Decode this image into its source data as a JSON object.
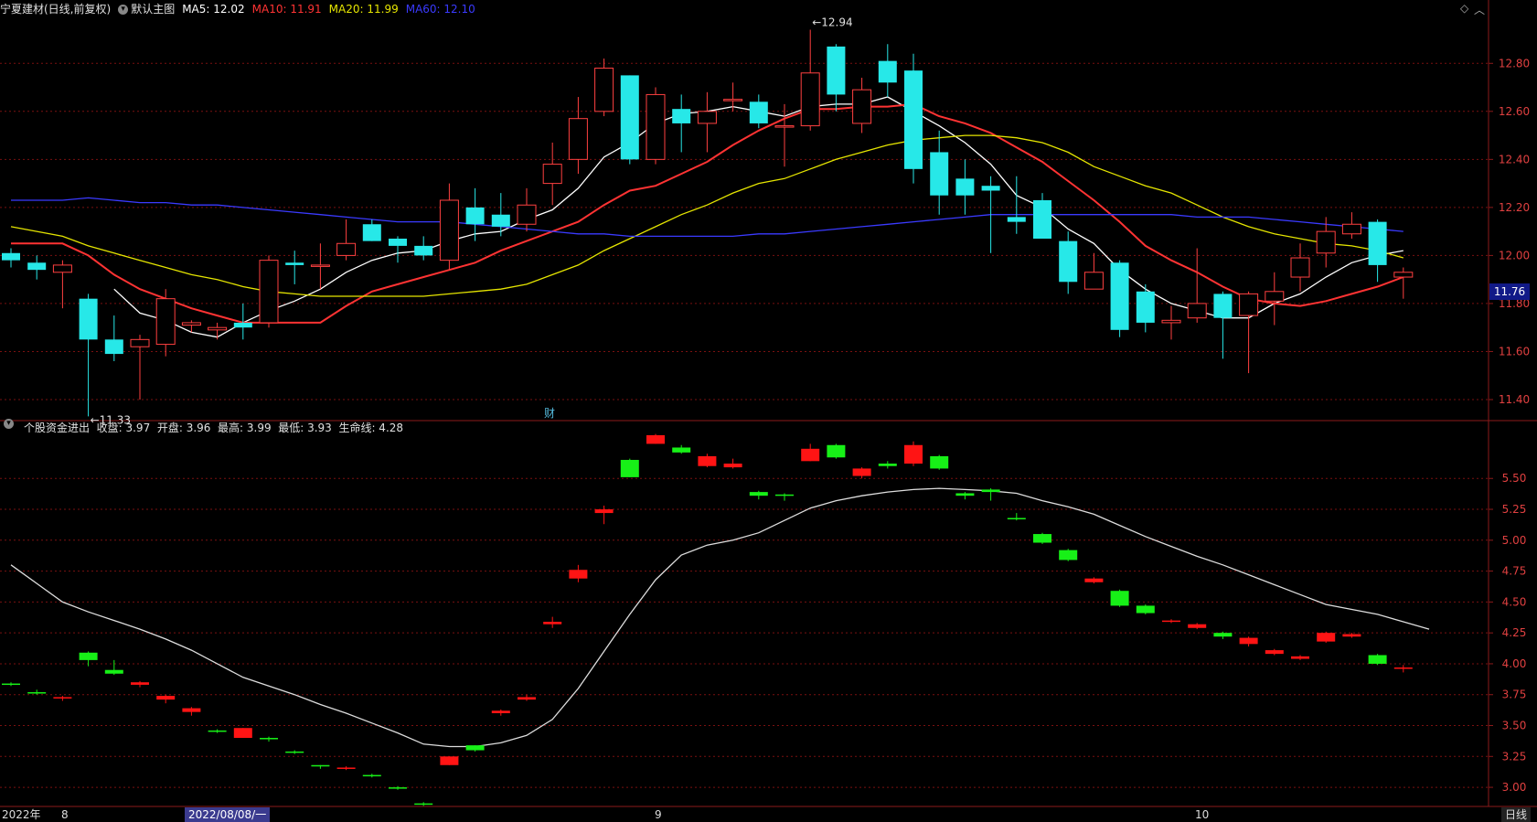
{
  "header": {
    "stock": "宁夏建材(日线,前复权)",
    "main_mode": "默认主图",
    "ma": [
      {
        "label": "MA5: 12.02",
        "color": "#ffffff"
      },
      {
        "label": "MA10: 11.91",
        "color": "#ff3333"
      },
      {
        "label": "MA20: 11.99",
        "color": "#e5e500"
      },
      {
        "label": "MA60: 12.10",
        "color": "#3a3aff"
      }
    ]
  },
  "indicator_header": "个股资金进出  收盘: 3.97  开盘: 3.96  最高: 3.99  最低: 3.93  生命线: 4.28",
  "current_price": "11.76",
  "fin_label": "财",
  "bottom_axis": {
    "labels": [
      "2022年",
      "8",
      "2022/08/08/一",
      "9",
      "10"
    ],
    "period": "日线"
  },
  "chart_data": [
    {
      "type": "candlestick",
      "title": "宁夏建材(日线,前复权)",
      "ylim": [
        11.32,
        12.98
      ],
      "yticks": [
        11.4,
        11.6,
        11.8,
        12.0,
        12.2,
        12.4,
        12.6,
        12.8
      ],
      "annotations": [
        {
          "text": "12.94",
          "bar": 31
        },
        {
          "text": "11.33",
          "bar": 3
        }
      ],
      "candles": [
        [
          12.01,
          11.98,
          12.03,
          11.95
        ],
        [
          11.97,
          11.94,
          12.0,
          11.9
        ],
        [
          11.93,
          11.96,
          11.98,
          11.78
        ],
        [
          11.82,
          11.65,
          11.84,
          11.33
        ],
        [
          11.65,
          11.59,
          11.75,
          11.56
        ],
        [
          11.62,
          11.65,
          11.67,
          11.4
        ],
        [
          11.63,
          11.82,
          11.86,
          11.58
        ],
        [
          11.71,
          11.72,
          11.73,
          11.68
        ],
        [
          11.69,
          11.7,
          11.72,
          11.65
        ],
        [
          11.72,
          11.7,
          11.8,
          11.65
        ],
        [
          11.72,
          11.98,
          12.0,
          11.7
        ],
        [
          11.97,
          11.96,
          12.02,
          11.88
        ],
        [
          11.96,
          11.96,
          12.05,
          11.86
        ],
        [
          12.0,
          12.05,
          12.15,
          11.98
        ],
        [
          12.13,
          12.06,
          12.15,
          12.06
        ],
        [
          12.07,
          12.04,
          12.08,
          11.97
        ],
        [
          12.04,
          12.0,
          12.08,
          11.98
        ],
        [
          11.98,
          12.23,
          12.3,
          11.94
        ],
        [
          12.2,
          12.13,
          12.28,
          12.06
        ],
        [
          12.17,
          12.12,
          12.26,
          12.08
        ],
        [
          12.13,
          12.21,
          12.28,
          12.1
        ],
        [
          12.3,
          12.38,
          12.47,
          12.21
        ],
        [
          12.4,
          12.57,
          12.66,
          12.34
        ],
        [
          12.6,
          12.78,
          12.82,
          12.58
        ],
        [
          12.75,
          12.4,
          12.75,
          12.38
        ],
        [
          12.4,
          12.67,
          12.7,
          12.38
        ],
        [
          12.61,
          12.55,
          12.67,
          12.43
        ],
        [
          12.55,
          12.6,
          12.68,
          12.43
        ],
        [
          12.65,
          12.65,
          12.72,
          12.6
        ],
        [
          12.64,
          12.55,
          12.67,
          12.53
        ],
        [
          12.54,
          12.54,
          12.63,
          12.37
        ],
        [
          12.54,
          12.76,
          12.94,
          12.52
        ],
        [
          12.87,
          12.67,
          12.88,
          12.6
        ],
        [
          12.55,
          12.69,
          12.74,
          12.51
        ],
        [
          12.81,
          12.72,
          12.88,
          12.66
        ],
        [
          12.77,
          12.36,
          12.84,
          12.3
        ],
        [
          12.43,
          12.25,
          12.52,
          12.17
        ],
        [
          12.32,
          12.25,
          12.4,
          12.17
        ],
        [
          12.29,
          12.27,
          12.33,
          12.01
        ],
        [
          12.16,
          12.14,
          12.33,
          12.09
        ],
        [
          12.23,
          12.07,
          12.26,
          12.07
        ],
        [
          12.06,
          11.89,
          12.1,
          11.84
        ],
        [
          11.86,
          11.93,
          12.01,
          11.87
        ],
        [
          11.97,
          11.69,
          11.98,
          11.66
        ],
        [
          11.85,
          11.72,
          11.88,
          11.68
        ],
        [
          11.72,
          11.73,
          11.79,
          11.65
        ],
        [
          11.74,
          11.8,
          12.03,
          11.72
        ],
        [
          11.84,
          11.74,
          11.85,
          11.57
        ],
        [
          11.75,
          11.84,
          11.85,
          11.51
        ],
        [
          11.81,
          11.85,
          11.93,
          11.71
        ],
        [
          11.91,
          11.99,
          12.05,
          11.85
        ],
        [
          12.01,
          12.1,
          12.16,
          11.95
        ],
        [
          12.09,
          12.13,
          12.18,
          12.07
        ],
        [
          12.14,
          11.96,
          12.15,
          11.89
        ],
        [
          11.91,
          11.93,
          11.95,
          11.82
        ]
      ],
      "series": [
        {
          "name": "MA5",
          "color": "#ffffff",
          "values": [
            null,
            null,
            null,
            null,
            11.86,
            11.76,
            11.73,
            11.68,
            11.66,
            11.72,
            11.77,
            11.81,
            11.86,
            11.93,
            11.98,
            12.01,
            12.02,
            12.06,
            12.09,
            12.1,
            12.15,
            12.19,
            12.28,
            12.41,
            12.47,
            12.55,
            12.59,
            12.6,
            12.62,
            12.6,
            12.58,
            12.62,
            12.63,
            12.63,
            12.66,
            12.6,
            12.54,
            12.47,
            12.38,
            12.25,
            12.2,
            12.11,
            12.05,
            11.94,
            11.86,
            11.8,
            11.77,
            11.74,
            11.74,
            11.8,
            11.84,
            11.91,
            11.97,
            12.0,
            12.02
          ]
        },
        {
          "name": "MA10",
          "color": "#ff3333",
          "values": [
            12.05,
            12.05,
            12.05,
            12.0,
            11.92,
            11.86,
            11.82,
            11.78,
            11.75,
            11.72,
            11.72,
            11.72,
            11.72,
            11.79,
            11.85,
            11.88,
            11.91,
            11.94,
            11.97,
            12.02,
            12.06,
            12.1,
            12.14,
            12.21,
            12.27,
            12.29,
            12.34,
            12.39,
            12.46,
            12.52,
            12.57,
            12.61,
            12.61,
            12.62,
            12.62,
            12.63,
            12.58,
            12.55,
            12.51,
            12.45,
            12.39,
            12.31,
            12.23,
            12.14,
            12.04,
            11.98,
            11.93,
            11.87,
            11.82,
            11.8,
            11.79,
            11.81,
            11.84,
            11.87,
            11.91
          ]
        },
        {
          "name": "MA20",
          "color": "#e5e500",
          "values": [
            12.12,
            12.1,
            12.08,
            12.04,
            12.01,
            11.98,
            11.95,
            11.92,
            11.9,
            11.87,
            11.85,
            11.84,
            11.83,
            11.83,
            11.83,
            11.83,
            11.83,
            11.84,
            11.85,
            11.86,
            11.88,
            11.92,
            11.96,
            12.02,
            12.07,
            12.12,
            12.17,
            12.21,
            12.26,
            12.3,
            12.32,
            12.36,
            12.4,
            12.43,
            12.46,
            12.48,
            12.49,
            12.5,
            12.5,
            12.49,
            12.47,
            12.43,
            12.37,
            12.33,
            12.29,
            12.26,
            12.21,
            12.16,
            12.12,
            12.09,
            12.07,
            12.05,
            12.04,
            12.02,
            11.99
          ]
        },
        {
          "name": "MA60",
          "color": "#3a3aff",
          "values": [
            12.23,
            12.23,
            12.23,
            12.24,
            12.23,
            12.22,
            12.22,
            12.21,
            12.21,
            12.2,
            12.19,
            12.18,
            12.17,
            12.16,
            12.15,
            12.14,
            12.14,
            12.14,
            12.13,
            12.12,
            12.11,
            12.1,
            12.09,
            12.09,
            12.08,
            12.08,
            12.08,
            12.08,
            12.08,
            12.09,
            12.09,
            12.1,
            12.11,
            12.12,
            12.13,
            12.14,
            12.15,
            12.16,
            12.17,
            12.17,
            12.17,
            12.17,
            12.17,
            12.17,
            12.17,
            12.17,
            12.16,
            12.16,
            12.16,
            12.15,
            12.14,
            12.13,
            12.12,
            12.11,
            12.1
          ]
        }
      ]
    },
    {
      "type": "candlestick",
      "title": "个股资金进出",
      "ylim": [
        2.86,
        5.82
      ],
      "yticks": [
        3.0,
        3.25,
        3.5,
        3.75,
        4.0,
        4.25,
        4.5,
        4.75,
        5.0,
        5.25,
        5.5
      ],
      "candles": [
        [
          3.84,
          3.83,
          3.85,
          3.82
        ],
        [
          3.77,
          3.76,
          3.79,
          3.75
        ],
        [
          3.72,
          3.73,
          3.74,
          3.7
        ],
        [
          4.09,
          4.03,
          4.1,
          3.98
        ],
        [
          3.95,
          3.92,
          4.03,
          3.91
        ],
        [
          3.83,
          3.85,
          3.86,
          3.81
        ],
        [
          3.71,
          3.74,
          3.75,
          3.68
        ],
        [
          3.61,
          3.64,
          3.65,
          3.58
        ],
        [
          3.46,
          3.45,
          3.47,
          3.44
        ],
        [
          3.4,
          3.48,
          3.48,
          3.4
        ],
        [
          3.4,
          3.39,
          3.41,
          3.37
        ],
        [
          3.29,
          3.28,
          3.3,
          3.27
        ],
        [
          3.18,
          3.17,
          3.18,
          3.15
        ],
        [
          3.15,
          3.16,
          3.17,
          3.14
        ],
        [
          3.1,
          3.09,
          3.11,
          3.08
        ],
        [
          3.0,
          2.99,
          3.01,
          2.98
        ],
        [
          2.87,
          2.86,
          2.88,
          2.85
        ],
        [
          3.18,
          3.25,
          3.25,
          3.18
        ],
        [
          3.34,
          3.3,
          3.34,
          3.29
        ],
        [
          3.6,
          3.62,
          3.63,
          3.58
        ],
        [
          3.71,
          3.73,
          3.75,
          3.7
        ],
        [
          4.32,
          4.34,
          4.38,
          4.29
        ],
        [
          4.69,
          4.76,
          4.8,
          4.66
        ],
        [
          5.22,
          5.25,
          5.28,
          5.13
        ],
        [
          5.65,
          5.51,
          5.66,
          5.51
        ],
        [
          5.78,
          5.85,
          5.86,
          5.78
        ],
        [
          5.75,
          5.71,
          5.77,
          5.7
        ],
        [
          5.6,
          5.68,
          5.7,
          5.59
        ],
        [
          5.59,
          5.62,
          5.66,
          5.58
        ],
        [
          5.39,
          5.36,
          5.4,
          5.33
        ],
        [
          5.37,
          5.36,
          5.38,
          5.32
        ],
        [
          5.64,
          5.74,
          5.78,
          5.64
        ],
        [
          5.77,
          5.67,
          5.78,
          5.66
        ],
        [
          5.52,
          5.58,
          5.59,
          5.5
        ],
        [
          5.62,
          5.6,
          5.64,
          5.58
        ],
        [
          5.62,
          5.77,
          5.8,
          5.6
        ],
        [
          5.68,
          5.58,
          5.69,
          5.57
        ],
        [
          5.38,
          5.36,
          5.39,
          5.33
        ],
        [
          5.41,
          5.39,
          5.42,
          5.32
        ],
        [
          5.18,
          5.17,
          5.22,
          5.16
        ],
        [
          5.05,
          4.98,
          5.06,
          4.97
        ],
        [
          4.92,
          4.84,
          4.93,
          4.83
        ],
        [
          4.66,
          4.69,
          4.7,
          4.65
        ],
        [
          4.59,
          4.47,
          4.6,
          4.46
        ],
        [
          4.47,
          4.41,
          4.48,
          4.4
        ],
        [
          4.34,
          4.35,
          4.36,
          4.33
        ],
        [
          4.29,
          4.32,
          4.33,
          4.28
        ],
        [
          4.25,
          4.22,
          4.26,
          4.2
        ],
        [
          4.16,
          4.21,
          4.22,
          4.14
        ],
        [
          4.08,
          4.11,
          4.12,
          4.07
        ],
        [
          4.04,
          4.06,
          4.07,
          4.03
        ],
        [
          4.18,
          4.25,
          4.26,
          4.17
        ],
        [
          4.22,
          4.24,
          4.25,
          4.21
        ],
        [
          4.07,
          4.0,
          4.08,
          3.99
        ],
        [
          3.96,
          3.97,
          3.99,
          3.93
        ]
      ],
      "series": [
        {
          "name": "生命线",
          "color": "#dddddd",
          "values": [
            4.8,
            4.65,
            4.5,
            4.42,
            4.35,
            4.28,
            4.2,
            4.11,
            4.0,
            3.89,
            3.82,
            3.75,
            3.67,
            3.6,
            3.52,
            3.44,
            3.35,
            3.33,
            3.33,
            3.36,
            3.42,
            3.55,
            3.8,
            4.1,
            4.4,
            4.68,
            4.88,
            4.96,
            5.0,
            5.06,
            5.16,
            5.26,
            5.32,
            5.36,
            5.39,
            5.41,
            5.42,
            5.41,
            5.4,
            5.38,
            5.32,
            5.27,
            5.21,
            5.12,
            5.03,
            4.95,
            4.87,
            4.8,
            4.72,
            4.64,
            4.56,
            4.48,
            4.44,
            4.4,
            4.34,
            4.28
          ]
        }
      ]
    }
  ]
}
